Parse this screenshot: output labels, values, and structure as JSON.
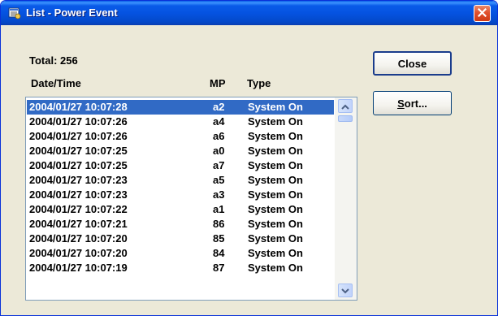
{
  "window": {
    "title": "List - Power Event"
  },
  "summary": {
    "total_label": "Total:",
    "total_value": "256"
  },
  "columns": {
    "datetime": "Date/Time",
    "mp": "MP",
    "type": "Type"
  },
  "rows": [
    {
      "datetime": "2004/01/27 10:07:28",
      "mp": "a2",
      "type": "System On",
      "selected": true
    },
    {
      "datetime": "2004/01/27 10:07:26",
      "mp": "a4",
      "type": "System On"
    },
    {
      "datetime": "2004/01/27 10:07:26",
      "mp": "a6",
      "type": "System On"
    },
    {
      "datetime": "2004/01/27 10:07:25",
      "mp": "a0",
      "type": "System On"
    },
    {
      "datetime": "2004/01/27 10:07:25",
      "mp": "a7",
      "type": "System On"
    },
    {
      "datetime": "2004/01/27 10:07:23",
      "mp": "a5",
      "type": "System On"
    },
    {
      "datetime": "2004/01/27 10:07:23",
      "mp": "a3",
      "type": "System On"
    },
    {
      "datetime": "2004/01/27 10:07:22",
      "mp": "a1",
      "type": "System On"
    },
    {
      "datetime": "2004/01/27 10:07:21",
      "mp": "86",
      "type": "System On"
    },
    {
      "datetime": "2004/01/27 10:07:20",
      "mp": "85",
      "type": "System On"
    },
    {
      "datetime": "2004/01/27 10:07:20",
      "mp": "84",
      "type": "System On"
    },
    {
      "datetime": "2004/01/27 10:07:19",
      "mp": "87",
      "type": "System On"
    }
  ],
  "buttons": {
    "close": "Close",
    "sort": "Sort..."
  },
  "icons": {
    "app": "list-app-icon",
    "close": "close-icon",
    "scroll_up": "arrow-up-icon",
    "scroll_down": "arrow-down-icon"
  },
  "colors": {
    "titlebar": "#0553e1",
    "window_bg": "#ece9d8",
    "selection": "#316ac5",
    "close_button": "#e1512d"
  }
}
